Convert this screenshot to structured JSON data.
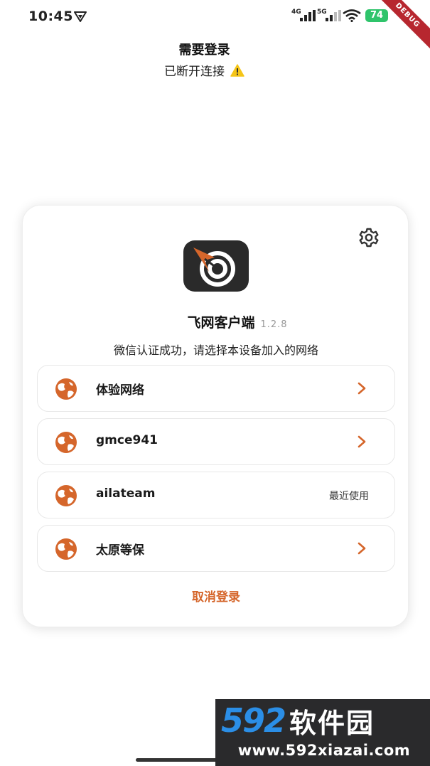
{
  "status_bar": {
    "time": "10:45",
    "network_4g": "4G",
    "network_5g": "5G",
    "battery": "74",
    "debug_banner": "DEBUG",
    "icons": [
      "vpn-icon",
      "signal-icon",
      "wifi-icon",
      "battery-icon"
    ]
  },
  "header": {
    "title": "需要登录",
    "subtitle": "已断开连接",
    "warning_color": "#f5c518"
  },
  "card": {
    "app_name": "飞网客户端",
    "version": "1.2.8",
    "instruction": "微信认证成功，请选择本设备加入的网络",
    "networks": [
      {
        "name": "体验网络",
        "trailing": "chevron"
      },
      {
        "name": "gmce941",
        "trailing": "chevron"
      },
      {
        "name": "ailateam",
        "trailing": "最近使用"
      },
      {
        "name": "太原等保",
        "trailing": "chevron"
      }
    ],
    "cancel_label": "取消登录"
  },
  "colors": {
    "accent": "#d5662b",
    "logo_bg": "#2a2a2a",
    "battery_green": "#2fc46b"
  },
  "watermark": {
    "number": "592",
    "name": "软件园",
    "url": "www.592xiazai.com"
  }
}
